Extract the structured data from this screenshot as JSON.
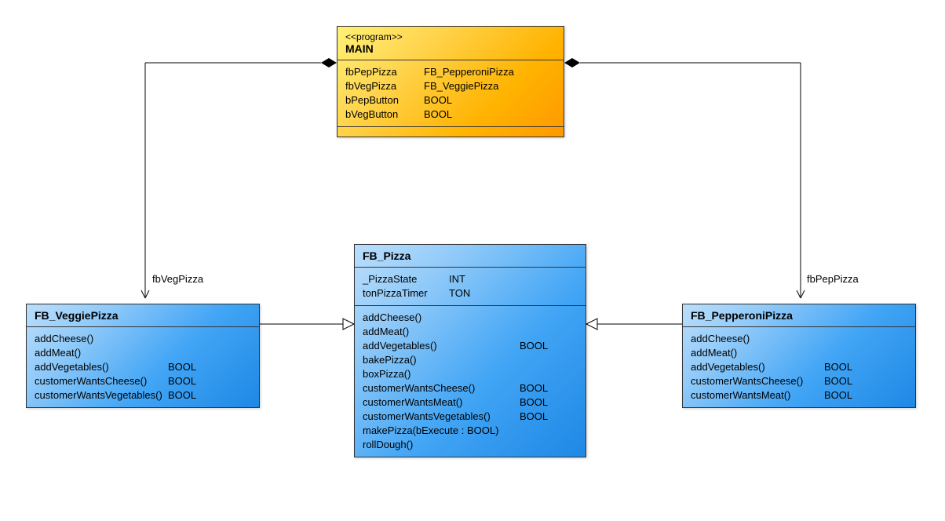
{
  "main": {
    "stereotype": "<<program>>",
    "name": "MAIN",
    "attrs": [
      {
        "name": "fbPepPizza",
        "type": "FB_PepperoniPizza"
      },
      {
        "name": "fbVegPizza",
        "type": "FB_VeggiePizza"
      },
      {
        "name": "bPepButton",
        "type": "BOOL"
      },
      {
        "name": "bVegButton",
        "type": "BOOL"
      }
    ]
  },
  "veggie": {
    "name": "FB_VeggiePizza",
    "methods": [
      {
        "name": "addCheese()",
        "type": ""
      },
      {
        "name": "addMeat()",
        "type": ""
      },
      {
        "name": "addVegetables()",
        "type": "BOOL"
      },
      {
        "name": "customerWantsCheese()",
        "type": "BOOL"
      },
      {
        "name": "customerWantsVegetables()",
        "type": "BOOL"
      }
    ]
  },
  "pizza": {
    "name": "FB_Pizza",
    "attrs": [
      {
        "name": "_PizzaState",
        "type": "INT"
      },
      {
        "name": "tonPizzaTimer",
        "type": "TON"
      }
    ],
    "methods": [
      {
        "name": "addCheese()",
        "type": ""
      },
      {
        "name": "addMeat()",
        "type": ""
      },
      {
        "name": "addVegetables()",
        "type": "BOOL"
      },
      {
        "name": "bakePizza()",
        "type": ""
      },
      {
        "name": "boxPizza()",
        "type": ""
      },
      {
        "name": "customerWantsCheese()",
        "type": "BOOL"
      },
      {
        "name": "customerWantsMeat()",
        "type": "BOOL"
      },
      {
        "name": "customerWantsVegetables()",
        "type": "BOOL"
      },
      {
        "name": "makePizza(bExecute : BOOL)",
        "type": ""
      },
      {
        "name": "rollDough()",
        "type": ""
      }
    ]
  },
  "pepperoni": {
    "name": "FB_PepperoniPizza",
    "methods": [
      {
        "name": "addCheese()",
        "type": ""
      },
      {
        "name": "addMeat()",
        "type": ""
      },
      {
        "name": "addVegetables()",
        "type": "BOOL"
      },
      {
        "name": "customerWantsCheese()",
        "type": "BOOL"
      },
      {
        "name": "customerWantsMeat()",
        "type": "BOOL"
      }
    ]
  },
  "labels": {
    "vegLink": "fbVegPizza",
    "pepLink": "fbPepPizza"
  }
}
